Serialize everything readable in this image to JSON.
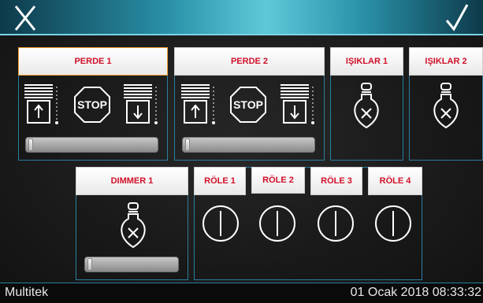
{
  "header": {
    "close_icon": "close-x-icon",
    "confirm_icon": "checkmark-icon"
  },
  "shutters": [
    {
      "label": "PERDE 1",
      "stop_label": "STOP",
      "position_percent": 0,
      "active": true
    },
    {
      "label": "PERDE 2",
      "stop_label": "STOP",
      "position_percent": 0,
      "active": false
    }
  ],
  "lights": [
    {
      "label": "IŞIKLAR 1",
      "state": "off"
    },
    {
      "label": "IŞIKLAR 2",
      "state": "off"
    }
  ],
  "dimmer": {
    "label": "DIMMER 1",
    "state": "off",
    "level_percent": 0
  },
  "relays": [
    {
      "label": "RÖLE 1",
      "state": "off"
    },
    {
      "label": "RÖLE 2",
      "state": "off"
    },
    {
      "label": "RÖLE 3",
      "state": "off"
    },
    {
      "label": "RÖLE 4",
      "state": "off"
    }
  ],
  "status": {
    "brand": "Multitek",
    "datetime": "01 Ocak 2018 08:33:32"
  },
  "colors": {
    "accent_blue": "#2a7fa0",
    "label_red": "#d2102a",
    "active_outline": "#f0a030"
  }
}
